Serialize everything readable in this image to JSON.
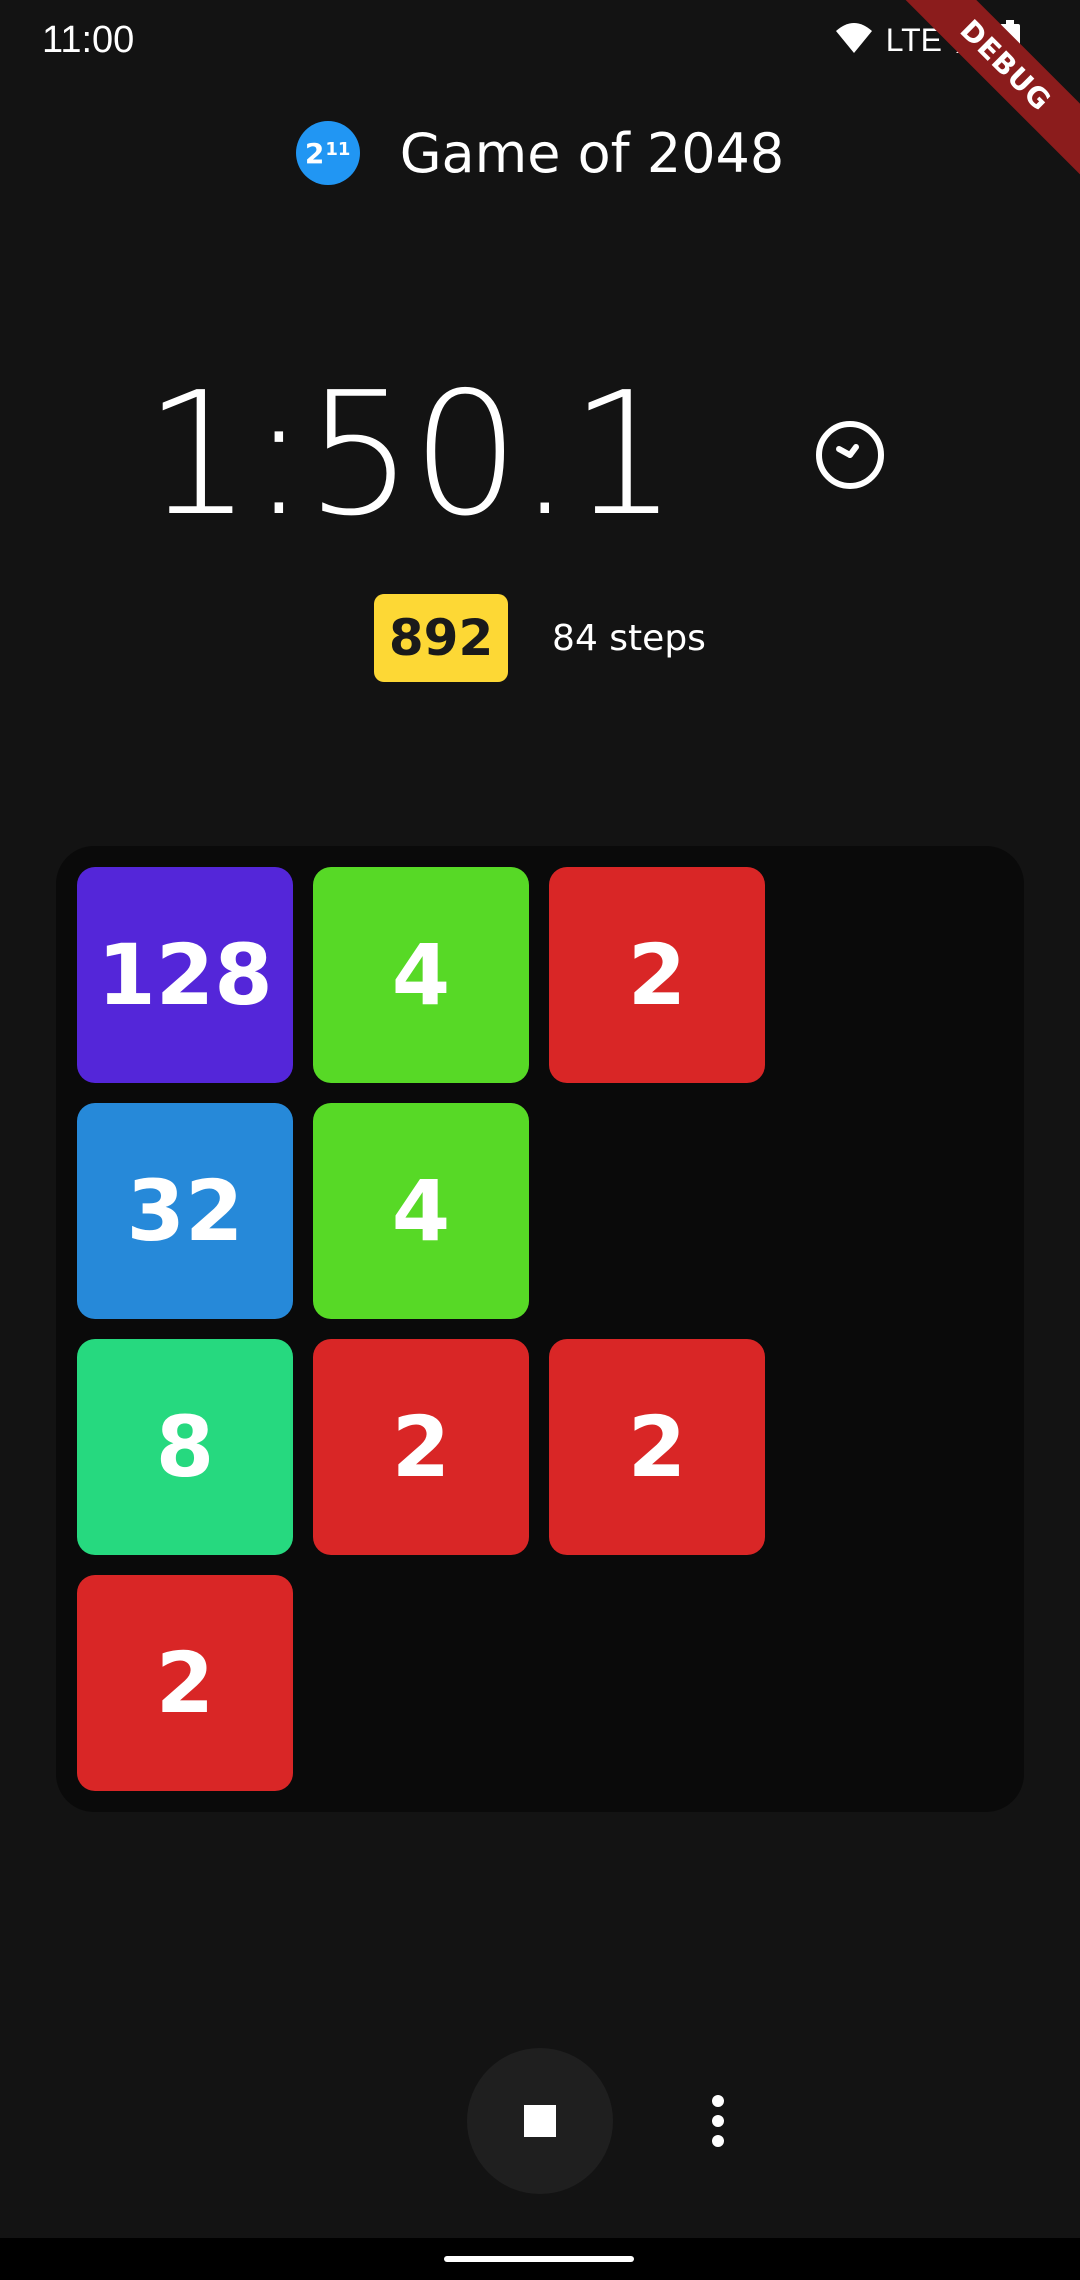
{
  "status_bar": {
    "time": "11:00",
    "network": "LTE",
    "icons": [
      "wifi-icon",
      "cellular-signal-icon",
      "battery-icon"
    ],
    "debug_label": "DEBUG"
  },
  "header": {
    "logo_base": "2",
    "logo_exponent": "11",
    "title": "Game of 2048"
  },
  "timer": {
    "elapsed": "1:50.1",
    "icon": "clock-icon"
  },
  "stats": {
    "score": "892",
    "steps": "84 steps"
  },
  "board": {
    "size": 4,
    "cells": [
      [
        128,
        4,
        2,
        null
      ],
      [
        32,
        4,
        null,
        null
      ],
      [
        8,
        2,
        2,
        null
      ],
      [
        2,
        null,
        null,
        null
      ]
    ],
    "tile_colors": {
      "2": "#d92626",
      "4": "#57d926",
      "8": "#26d97f",
      "32": "#2689d9",
      "128": "#5426d9"
    }
  },
  "controls": {
    "stop_icon": "stop-icon",
    "menu_icon": "more-vert-icon"
  }
}
